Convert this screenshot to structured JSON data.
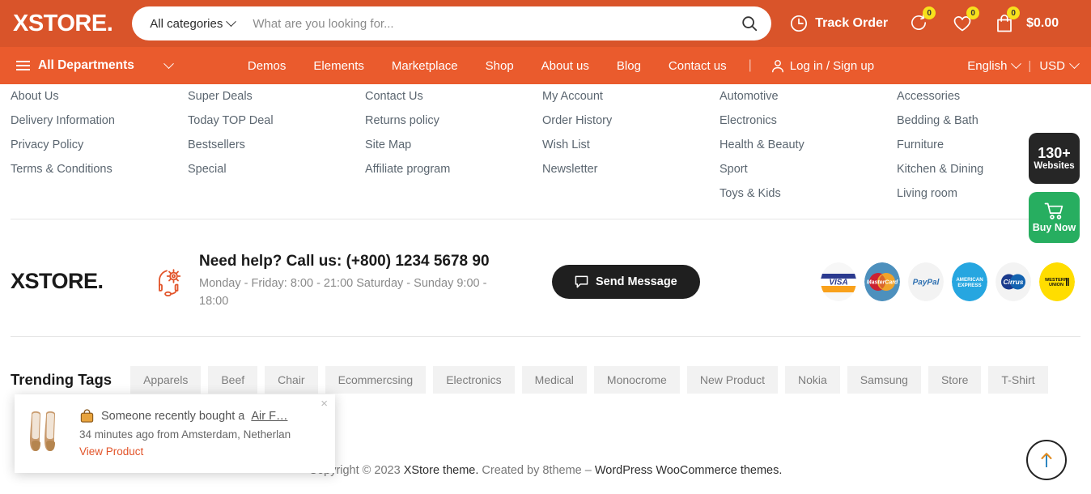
{
  "brand": {
    "logo": "XSTORE.",
    "accent": "#e2542a",
    "topbar_bg": "#d9542a",
    "nav_bg": "#ea5b2d"
  },
  "search": {
    "category_label": "All categories",
    "placeholder": "What are you looking for...",
    "value": ""
  },
  "topbar": {
    "track_order": "Track Order",
    "compare_count": "0",
    "wishlist_count": "0",
    "cart_count": "0",
    "cart_total": "$0.00"
  },
  "nav": {
    "all_departments": "All Departments",
    "links": [
      "Demos",
      "Elements",
      "Marketplace",
      "Shop",
      "About us",
      "Blog",
      "Contact us"
    ],
    "auth": "Log in / Sign up",
    "divider": "|",
    "language": "English",
    "currency": "USD"
  },
  "footer_columns": [
    {
      "links": [
        "About Us",
        "Delivery Information",
        "Privacy Policy",
        "Terms & Conditions"
      ]
    },
    {
      "links": [
        "Super Deals",
        "Today TOP Deal",
        "Bestsellers",
        "Special"
      ]
    },
    {
      "links": [
        "Contact Us",
        "Returns policy",
        "Site Map",
        "Affiliate program"
      ]
    },
    {
      "links": [
        "My Account",
        "Order History",
        "Wish List",
        "Newsletter"
      ]
    },
    {
      "links": [
        "Automotive",
        "Electronics",
        "Health & Beauty",
        "Sport",
        "Toys & Kids"
      ]
    },
    {
      "links": [
        "Accessories",
        "Bedding & Bath",
        "Furniture",
        "Kitchen & Dining",
        "Living room"
      ]
    }
  ],
  "side_badges": {
    "websites_count": "130+",
    "websites_label": "Websites",
    "buy_now": "Buy Now"
  },
  "help": {
    "logo": "XSTORE.",
    "title": "Need help? Call us: (+800) 1234 5678 90",
    "hours": "Monday - Friday: 8:00 - 21:00 Saturday - Sunday 9:00 - 18:00",
    "send_message": "Send Message"
  },
  "payments": [
    {
      "name": "VISA",
      "text": "VISA"
    },
    {
      "name": "MasterCard",
      "text": "MasterCard"
    },
    {
      "name": "PayPal",
      "text": "PayPal"
    },
    {
      "name": "American Express",
      "text": "AMERICAN EXPRESS"
    },
    {
      "name": "Cirrus",
      "text": "Cirrus"
    },
    {
      "name": "Western Union",
      "text": "WESTERN UNION"
    }
  ],
  "trending": {
    "title": "Trending Tags",
    "tags": [
      "Apparels",
      "Beef",
      "Chair",
      "Ecommercsing",
      "Electronics",
      "Medical",
      "Monocrome",
      "New Product",
      "Nokia",
      "Samsung",
      "Store",
      "T-Shirt"
    ]
  },
  "copyright": {
    "prefix": "Copyright © 2023 ",
    "store": "XStore theme.",
    "middle": " Created by 8theme – ",
    "suffix": "WordPress WooCommerce themes."
  },
  "popup": {
    "message_prefix": "Someone recently bought a ",
    "product": "Air F…",
    "time_location": "34 minutes ago from Amsterdam, Netherlan",
    "view_product": "View Product",
    "close": "×"
  }
}
